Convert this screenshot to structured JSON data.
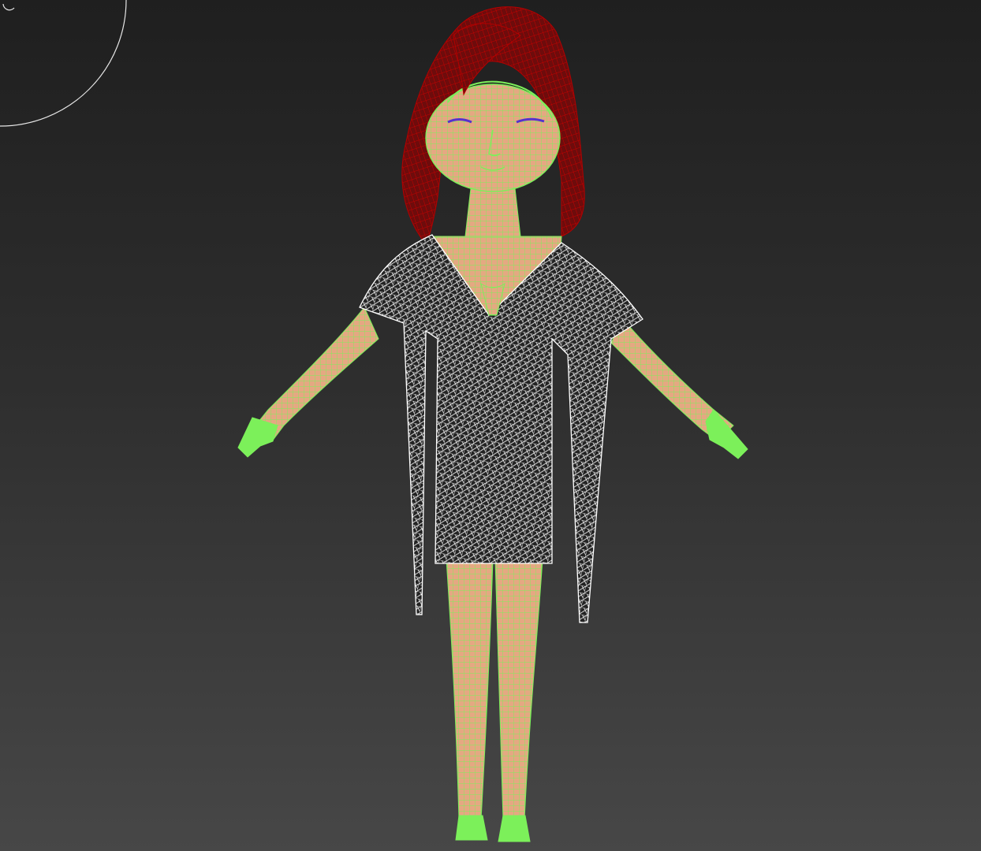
{
  "viewport": {
    "background_top": "#1f1f1f",
    "background_bottom": "#474747"
  },
  "model": {
    "hair_wire_color": "#b30000",
    "hair_fill_color": "#6e0c0c",
    "skin_wire_color": "#7cf05a",
    "skin_fill_color": "#e5a882",
    "cloth_wire_color": "#ffffff",
    "eye_color": "#5533cc"
  },
  "gizmo": {
    "icon": "view-cube-circle-icon",
    "color": "#e6e6e6"
  }
}
